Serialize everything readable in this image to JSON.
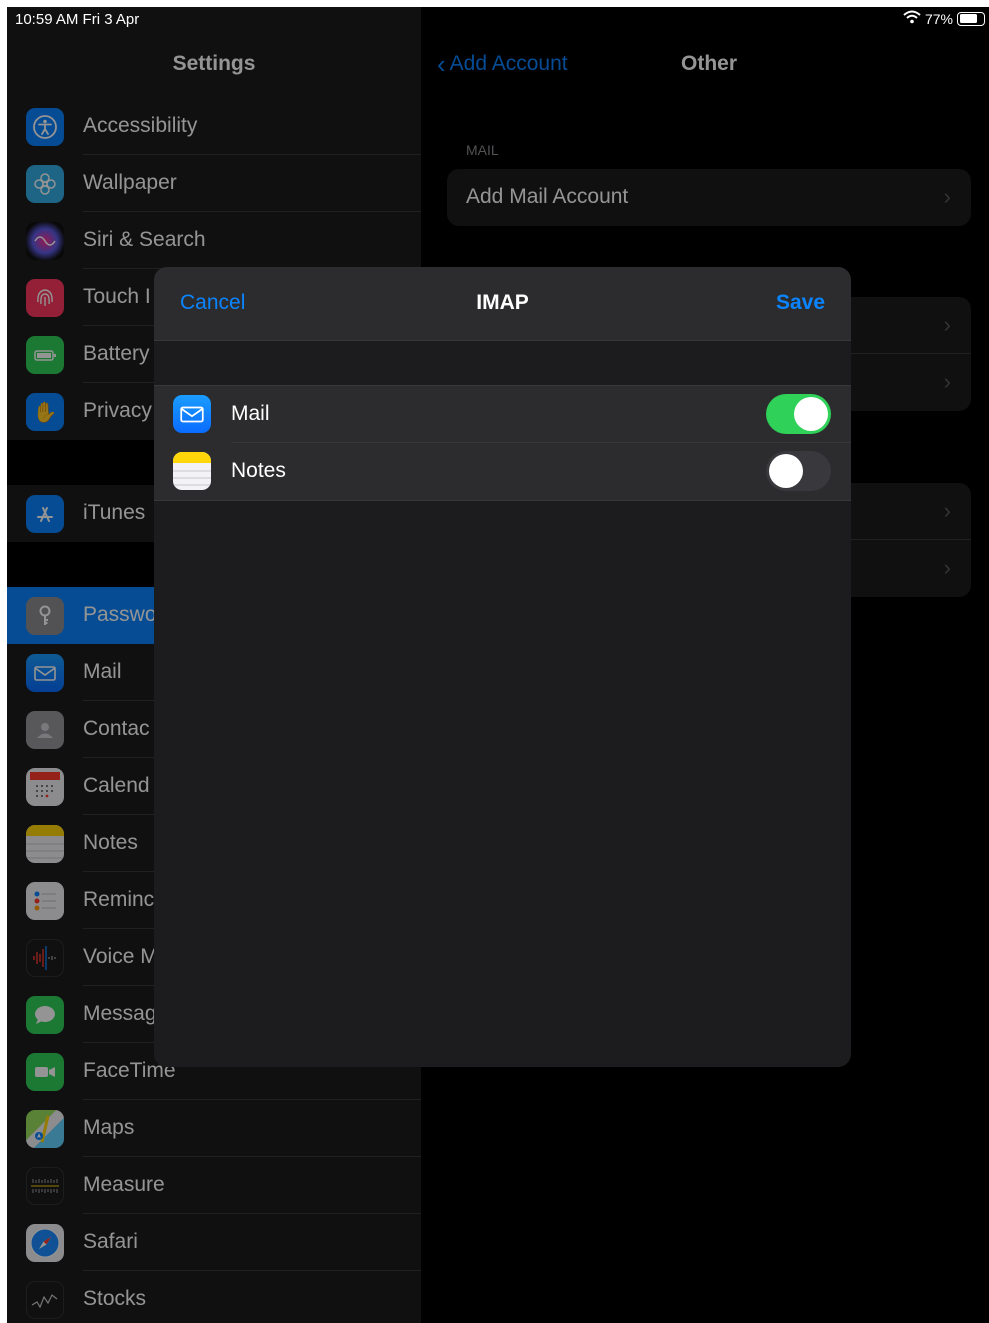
{
  "status_bar": {
    "time": "10:59 AM   Fri 3 Apr",
    "battery": "77%"
  },
  "sidebar": {
    "title": "Settings",
    "items": [
      {
        "label": "Accessibility",
        "icon": "accessibility-icon",
        "color": "#0a84ff"
      },
      {
        "label": "Wallpaper",
        "icon": "wallpaper-icon",
        "color": "#32ade6"
      },
      {
        "label": "Siri & Search",
        "icon": "siri-icon",
        "color": "#1c1c1e"
      },
      {
        "label": "Touch I",
        "icon": "touch-id-icon",
        "color": "#ff375f"
      },
      {
        "label": "Battery",
        "icon": "battery-icon",
        "color": "#30d158"
      },
      {
        "label": "Privacy",
        "icon": "privacy-hand-icon",
        "color": "#0a84ff"
      },
      {
        "label": "iTunes",
        "icon": "app-store-icon",
        "color": "#0a84ff"
      },
      {
        "label": "Passwo",
        "icon": "key-icon",
        "color": "#8e8e93"
      },
      {
        "label": "Mail",
        "icon": "mail-icon",
        "color": "#0a84ff"
      },
      {
        "label": "Contac",
        "icon": "contacts-icon",
        "color": "#8e8e93"
      },
      {
        "label": "Calend",
        "icon": "calendar-icon",
        "color": "#ffffff"
      },
      {
        "label": "Notes",
        "icon": "notes-icon",
        "color": "#ffd60a"
      },
      {
        "label": "Reminc",
        "icon": "reminders-icon",
        "color": "#ffffff"
      },
      {
        "label": "Voice M",
        "icon": "voice-memos-icon",
        "color": "#1c1c1e"
      },
      {
        "label": "Messag",
        "icon": "messages-icon",
        "color": "#30d158"
      },
      {
        "label": "FaceTime",
        "icon": "facetime-icon",
        "color": "#30d158"
      },
      {
        "label": "Maps",
        "icon": "maps-icon",
        "color": "#64d2ff"
      },
      {
        "label": "Measure",
        "icon": "measure-icon",
        "color": "#1c1c1e"
      },
      {
        "label": "Safari",
        "icon": "safari-icon",
        "color": "#0a84ff"
      },
      {
        "label": "Stocks",
        "icon": "stocks-icon",
        "color": "#1c1c1e"
      }
    ]
  },
  "detail": {
    "back_label": "Add Account",
    "title": "Other",
    "mail_header": "MAIL",
    "add_mail_account": "Add Mail Account"
  },
  "modal": {
    "cancel_label": "Cancel",
    "title": "IMAP",
    "save_label": "Save",
    "rows": [
      {
        "label": "Mail",
        "icon": "mail-icon",
        "enabled": true
      },
      {
        "label": "Notes",
        "icon": "notes-icon",
        "enabled": false
      }
    ]
  },
  "colors": {
    "accent": "#0a84ff",
    "toggle_on": "#30d158",
    "background": "#000000",
    "panel": "#1c1c1e"
  }
}
